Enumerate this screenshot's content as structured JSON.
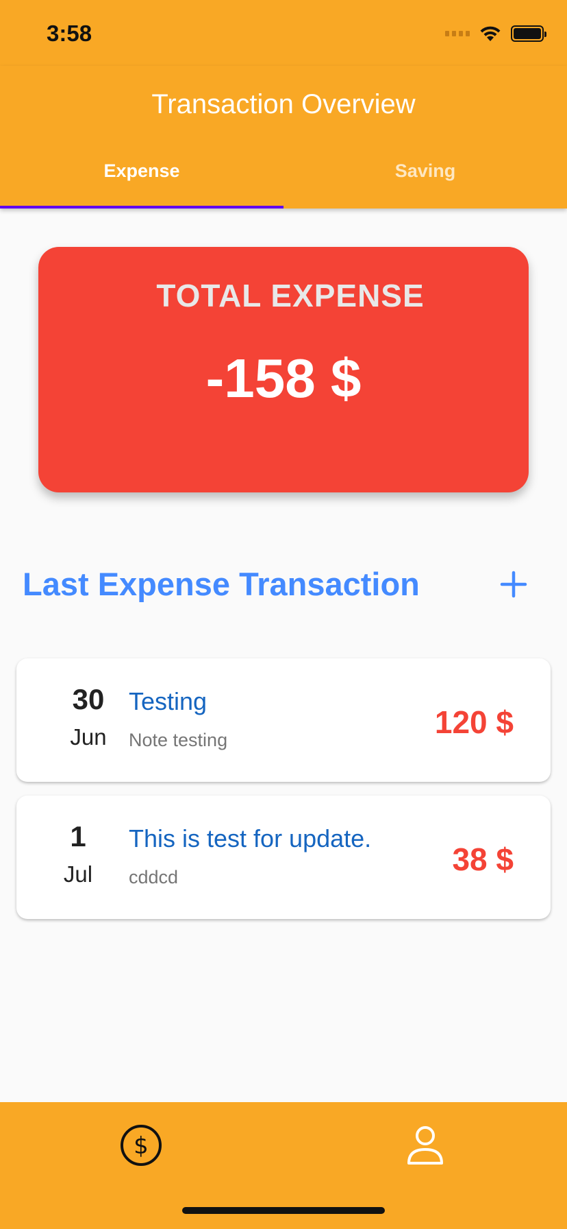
{
  "status_bar": {
    "time": "3:58",
    "icons": [
      "signal-icon",
      "wifi-icon",
      "battery-icon"
    ]
  },
  "app_bar": {
    "title": "Transaction Overview",
    "tabs": [
      {
        "label": "Expense",
        "selected": true
      },
      {
        "label": "Saving",
        "selected": false
      }
    ]
  },
  "summary": {
    "label": "TOTAL EXPENSE",
    "value": "-158 $"
  },
  "section": {
    "title": "Last Expense Transaction",
    "add_icon": "plus-icon"
  },
  "transactions": [
    {
      "day": "30",
      "month": "Jun",
      "title": "Testing",
      "note": "Note testing",
      "amount": "120 $"
    },
    {
      "day": "1",
      "month": "Jul",
      "title": "This is test for update.",
      "note": "cddcd",
      "amount": "38 $"
    }
  ],
  "bottom_nav": {
    "items": [
      {
        "icon": "dollar-circle-icon",
        "selected": true
      },
      {
        "icon": "person-icon",
        "selected": false
      }
    ]
  },
  "colors": {
    "primary": "#f9a825",
    "expense_card": "#f44336",
    "section_title": "#448aff",
    "transaction_title": "#1565c0",
    "tab_indicator": "#6200ee"
  }
}
